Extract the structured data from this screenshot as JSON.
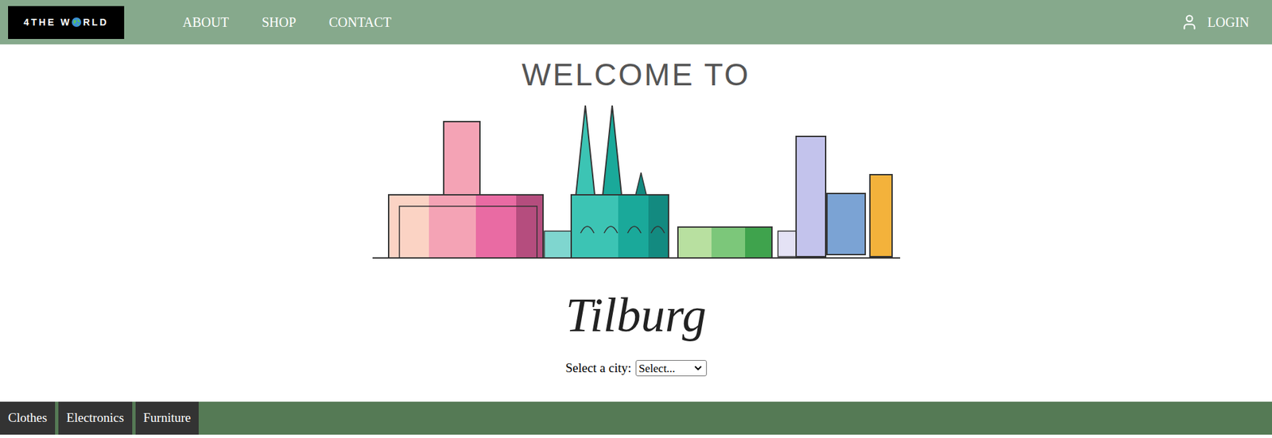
{
  "header": {
    "logo": {
      "before": "4THE W",
      "after": "RLD"
    },
    "nav": [
      {
        "label": "ABOUT"
      },
      {
        "label": "SHOP"
      },
      {
        "label": "CONTACT"
      }
    ],
    "login": "LOGIN"
  },
  "hero": {
    "greeting": "WELCOME TO",
    "city": "Tilburg",
    "select": {
      "label": "Select a city:",
      "value": "Select..."
    }
  },
  "categories": [
    {
      "label": "Clothes"
    },
    {
      "label": "Electronics"
    },
    {
      "label": "Furniture"
    }
  ]
}
